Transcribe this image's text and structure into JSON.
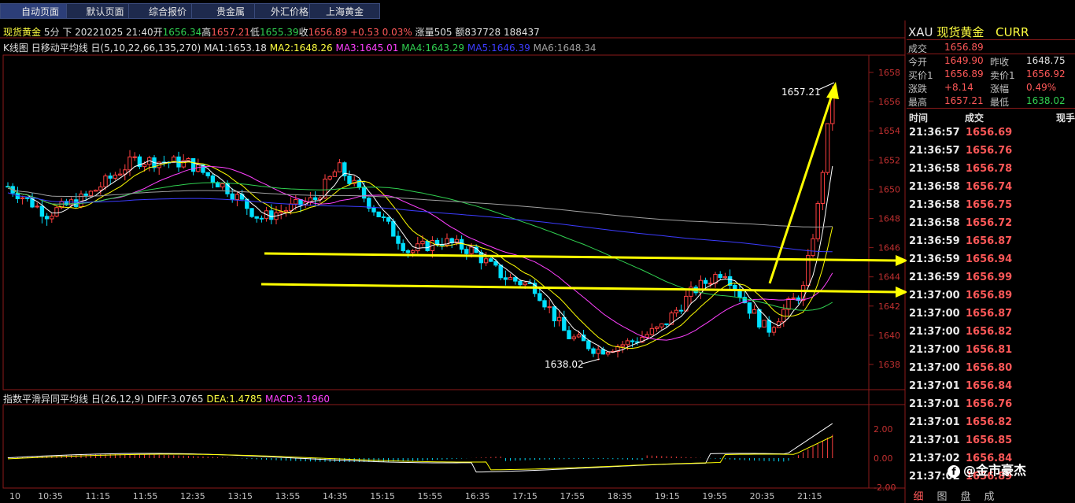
{
  "tabs": [
    {
      "label": "自动页面",
      "active": true
    },
    {
      "label": "默认页面",
      "active": false
    },
    {
      "label": "综合报价",
      "active": false
    },
    {
      "label": "贵金属",
      "active": false
    },
    {
      "label": "外汇价格",
      "active": false
    },
    {
      "label": "上海黄金",
      "active": false
    }
  ],
  "quote_bar": {
    "name": "现货黄金",
    "period": "5分",
    "direction": "下",
    "datetime": "20221025 21:40",
    "open_label": "开",
    "open": "1656.34",
    "high_label": "高",
    "high": "1657.21",
    "low_label": "低",
    "low": "1655.39",
    "close_label": "收",
    "close": "1656.89",
    "change": "+0.53",
    "change_pct": "0.03%",
    "vol_label": "涨",
    "vol": "量505",
    "amount": "额837728",
    "oi": "188437"
  },
  "ma_bar": {
    "title": "K线图",
    "indicator": "日移动平均线",
    "params": "日(5,10,22,66,135,270)",
    "ma1": "MA1:1653.18",
    "ma2": "MA2:1648.26",
    "ma3": "MA3:1645.01",
    "ma4": "MA4:1643.29",
    "ma5": "MA5:1646.39",
    "ma6": "MA6:1648.34"
  },
  "macd_bar": {
    "title": "指数平滑异同平均线",
    "params": "日(26,12,9)",
    "diff": "DIFF:3.0765",
    "dea": "DEA:1.4785",
    "macd": "MACD:3.1960"
  },
  "annotations": {
    "high_label": "1657.21",
    "low_label": "1638.02"
  },
  "price_axis": [
    "1658",
    "1656",
    "1654",
    "1652",
    "1650",
    "1648",
    "1646",
    "1644",
    "1642",
    "1640",
    "1638"
  ],
  "macd_axis": [
    "2.00",
    "0.00",
    "-2.00"
  ],
  "time_axis": [
    "10",
    "10:35",
    "11:15",
    "11:55",
    "12:35",
    "13:15",
    "13:55",
    "14:35",
    "15:15",
    "15:55",
    "16:35",
    "17:15",
    "17:55",
    "18:35",
    "19:15",
    "19:55",
    "20:35",
    "21:15"
  ],
  "colors": {
    "up": "#ff4040",
    "down": "#00e0ff",
    "arrow": "#ffff00",
    "ma1": "#ffffff",
    "ma2": "#ffff00",
    "ma3": "#ff40ff",
    "ma4": "#30d050",
    "ma5": "#3c3cff",
    "ma6": "#a0a0a0"
  },
  "right_panel": {
    "code": "XAU",
    "name": "现货黄金",
    "tag": "CURR",
    "last_label": "成交",
    "last": "1656.89",
    "open_label": "今开",
    "open": "1649.90",
    "prev_label": "昨收",
    "prev": "1648.75",
    "bid_label": "买价1",
    "bid": "1656.89",
    "ask_label": "卖价1",
    "ask": "1656.92",
    "chg_label": "涨跌",
    "chg": "+8.14",
    "pct_label": "涨幅",
    "pct": "0.49%",
    "high_label": "最高",
    "high": "1657.21",
    "low_label": "最低",
    "low": "1638.02",
    "col_time": "时间",
    "col_price": "成交",
    "col_extra": "现手",
    "ticks": [
      {
        "t": "21:36:57",
        "p": "1656.69"
      },
      {
        "t": "21:36:57",
        "p": "1656.76"
      },
      {
        "t": "21:36:58",
        "p": "1656.78"
      },
      {
        "t": "21:36:58",
        "p": "1656.74"
      },
      {
        "t": "21:36:58",
        "p": "1656.75"
      },
      {
        "t": "21:36:58",
        "p": "1656.72"
      },
      {
        "t": "21:36:59",
        "p": "1656.87"
      },
      {
        "t": "21:36:59",
        "p": "1656.94"
      },
      {
        "t": "21:36:59",
        "p": "1656.99"
      },
      {
        "t": "21:37:00",
        "p": "1656.89"
      },
      {
        "t": "21:37:00",
        "p": "1656.87"
      },
      {
        "t": "21:37:00",
        "p": "1656.82"
      },
      {
        "t": "21:37:00",
        "p": "1656.81"
      },
      {
        "t": "21:37:00",
        "p": "1656.80"
      },
      {
        "t": "21:37:01",
        "p": "1656.84"
      },
      {
        "t": "21:37:01",
        "p": "1656.76"
      },
      {
        "t": "21:37:01",
        "p": "1656.82"
      },
      {
        "t": "21:37:01",
        "p": "1656.85"
      },
      {
        "t": "21:37:02",
        "p": "1656.84"
      },
      {
        "t": "21:37:02",
        "p": "1656.89"
      }
    ],
    "bottom_tabs": [
      "细",
      "图",
      "盘",
      "成"
    ],
    "watermark": "@金市豪杰"
  }
}
